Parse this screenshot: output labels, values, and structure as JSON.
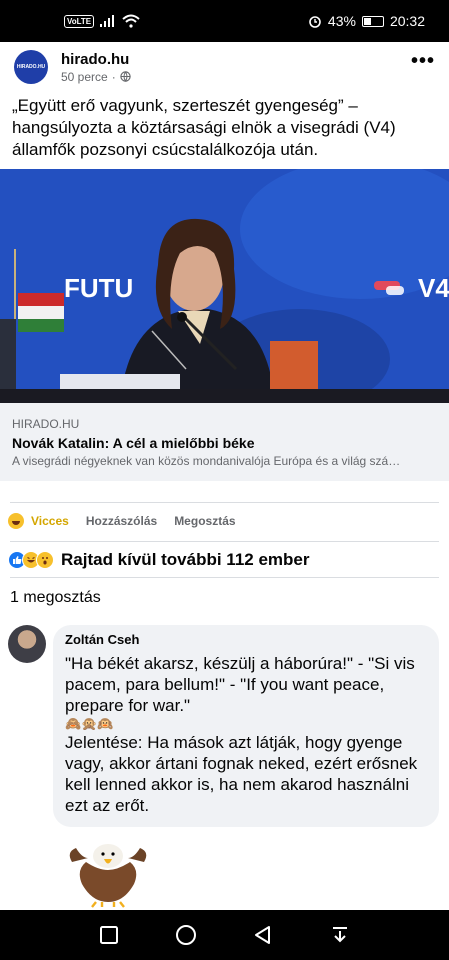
{
  "status_bar": {
    "network": "VoLTE",
    "alarm_icon": "alarm-icon",
    "battery": "43%",
    "battery_level": 0.43,
    "time": "20:32"
  },
  "post": {
    "page_name": "hirado.hu",
    "avatar_text": "HIRADO.HU",
    "time_ago": "50 perce",
    "separator": "·",
    "privacy_icon": "globe-icon",
    "text": "„Együtt erő vagyunk, szerteszét gyengeség” – hangsúlyozta a köztársasági elnök a visegrádi (V4) államfők pozsonyi csúcstalálkozója után."
  },
  "link_preview": {
    "domain": "HIRADO.HU",
    "title": "Novák Katalin: A cél a mielőbbi béke",
    "description": "A visegrádi négyeknek van közös mondanivalója Európa és a világ szá…"
  },
  "actions": {
    "reaction_label": "Vicces",
    "comment_label": "Hozzászólás",
    "share_label": "Megosztás"
  },
  "reactions": {
    "summary": "Rajtad kívül további 112 ember",
    "icons": [
      "like-icon",
      "haha-icon",
      "wow-icon"
    ]
  },
  "shares": {
    "count_text": "1 megosztás"
  },
  "comment": {
    "author": "Zoltán Cseh",
    "line1": "\"Ha békét akarsz, készülj a háborúra!\" - \"Si vis pacem, para bellum!\" - \"If you want peace, prepare for war.\"",
    "emoji": "🙈🙊🙉",
    "line2": "Jelentése: Ha mások azt látják, hogy gyenge vagy, akkor ártani fognak neked, ezért erősnek kell lenned akkor is, ha nem akarod használni ezt az erőt."
  },
  "image_text": {
    "fut": "FUTU",
    "v4": "V4"
  },
  "colors": {
    "brand_blue": "#1877f2",
    "haha_yellow": "#f7c02c",
    "active_reaction": "#d4a600"
  }
}
